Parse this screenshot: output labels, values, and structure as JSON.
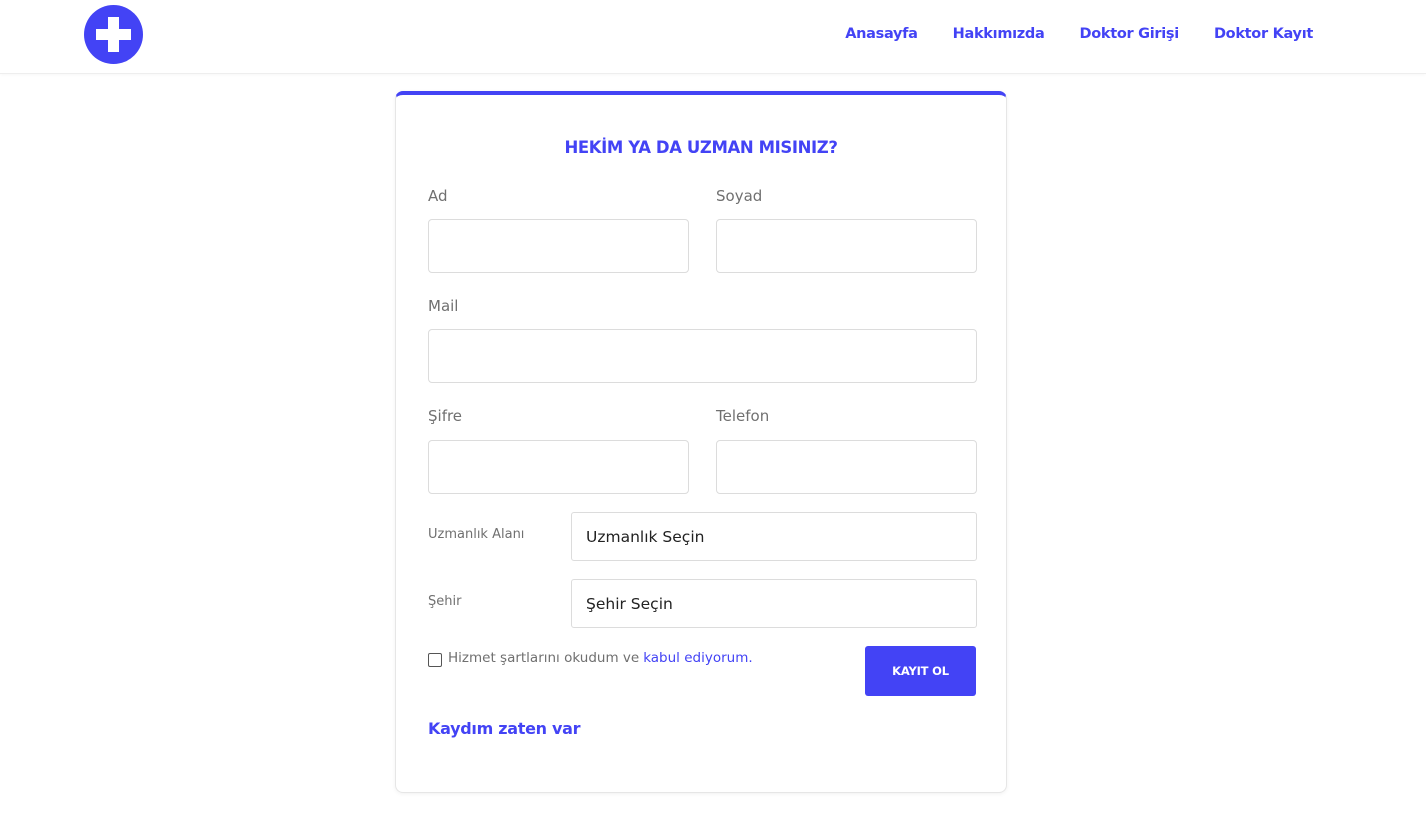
{
  "brand": {
    "accent_color": "#4343f5",
    "logo_icon": "medical-cross-icon"
  },
  "nav": {
    "items": [
      {
        "label": "Anasayfa"
      },
      {
        "label": "Hakkımızda"
      },
      {
        "label": "Doktor Girişi"
      },
      {
        "label": "Doktor Kayıt"
      }
    ]
  },
  "form": {
    "title": "HEKİM YA DA UZMAN MISINIZ?",
    "first_name": {
      "label": "Ad",
      "value": ""
    },
    "last_name": {
      "label": "Soyad",
      "value": ""
    },
    "email": {
      "label": "Mail",
      "value": ""
    },
    "password": {
      "label": "Şifre",
      "value": ""
    },
    "phone": {
      "label": "Telefon",
      "value": ""
    },
    "specialty": {
      "label": "Uzmanlık Alanı",
      "selected": "Uzmanlık Seçin"
    },
    "city": {
      "label": "Şehir",
      "selected": "Şehir Seçin"
    },
    "terms": {
      "checked": false,
      "text": "Hizmet şartlarını okudum ve",
      "link": "kabul ediyorum."
    },
    "submit_label": "KAYIT OL",
    "login_link": "Kaydım zaten var"
  }
}
